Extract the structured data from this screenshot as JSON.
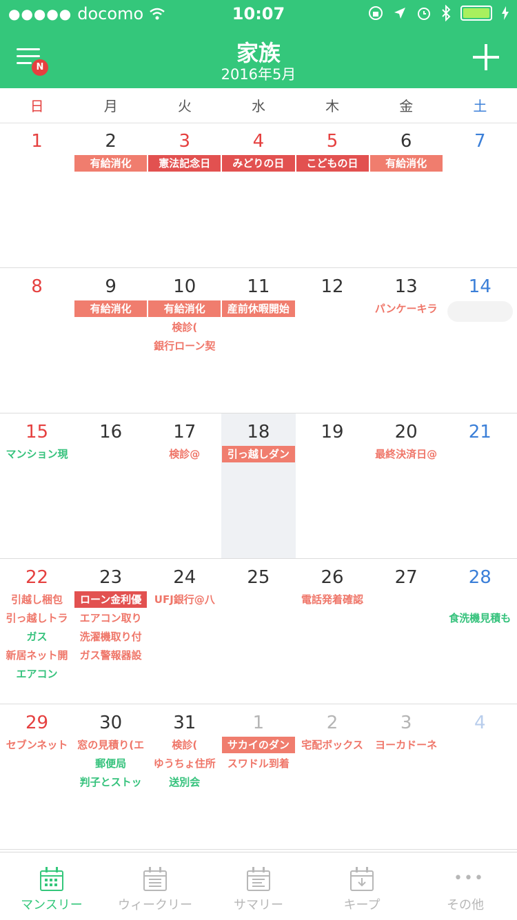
{
  "status": {
    "carrier": "docomo",
    "signal_dots": "●●●●●",
    "time": "10:07"
  },
  "header": {
    "title": "家族",
    "subtitle": "2016年5月",
    "badge": "N"
  },
  "weekdays": [
    "日",
    "月",
    "火",
    "水",
    "木",
    "金",
    "土"
  ],
  "weeks": [
    {
      "days": [
        {
          "n": "1",
          "t": "sun",
          "events": []
        },
        {
          "n": "2",
          "events": [
            {
              "label": "有給消化",
              "style": "fill"
            }
          ]
        },
        {
          "n": "3",
          "t": "sun",
          "events": [
            {
              "label": "憲法記念日",
              "style": "fill dark"
            }
          ]
        },
        {
          "n": "4",
          "t": "sun",
          "events": [
            {
              "label": "みどりの日",
              "style": "fill dark"
            }
          ]
        },
        {
          "n": "5",
          "t": "sun",
          "events": [
            {
              "label": "こどもの日",
              "style": "fill dark"
            }
          ]
        },
        {
          "n": "6",
          "events": [
            {
              "label": "有給消化",
              "style": "fill"
            }
          ]
        },
        {
          "n": "7",
          "t": "sat",
          "events": []
        }
      ]
    },
    {
      "days": [
        {
          "n": "8",
          "t": "sun",
          "events": []
        },
        {
          "n": "9",
          "events": [
            {
              "label": "有給消化",
              "style": "fill"
            }
          ]
        },
        {
          "n": "10",
          "events": [
            {
              "label": "有給消化",
              "style": "fill"
            },
            {
              "label": "検診(",
              "style": "text"
            },
            {
              "label": "銀行ローン契",
              "style": "text"
            }
          ]
        },
        {
          "n": "11",
          "events": [
            {
              "label": "産前休暇開始",
              "style": "fill"
            }
          ]
        },
        {
          "n": "12",
          "events": []
        },
        {
          "n": "13",
          "events": [
            {
              "label": "パンケーキラ",
              "style": "text"
            }
          ]
        },
        {
          "n": "14",
          "t": "sat",
          "events": [
            {
              "label": "",
              "style": "ghost"
            }
          ]
        }
      ]
    },
    {
      "days": [
        {
          "n": "15",
          "t": "sun",
          "events": [
            {
              "label": "マンション現",
              "style": "green"
            }
          ]
        },
        {
          "n": "16",
          "events": []
        },
        {
          "n": "17",
          "events": [
            {
              "label": "検診@",
              "style": "text"
            }
          ]
        },
        {
          "n": "18",
          "today": true,
          "events": [
            {
              "label": "引っ越しダン",
              "style": "fill"
            }
          ]
        },
        {
          "n": "19",
          "events": []
        },
        {
          "n": "20",
          "events": [
            {
              "label": "最終決済日@",
              "style": "text"
            }
          ]
        },
        {
          "n": "21",
          "t": "sat",
          "events": []
        }
      ]
    },
    {
      "days": [
        {
          "n": "22",
          "t": "sun",
          "events": [
            {
              "label": "引越し梱包",
              "style": "text"
            },
            {
              "label": "引っ越しトラ",
              "style": "text"
            },
            {
              "label": "ガス",
              "style": "green"
            },
            {
              "label": "新居ネット開",
              "style": "text"
            },
            {
              "label": "エアコン",
              "style": "green"
            }
          ]
        },
        {
          "n": "23",
          "events": [
            {
              "label": "ローン金利優",
              "style": "fill dark"
            },
            {
              "label": "エアコン取り",
              "style": "text"
            },
            {
              "label": "洗濯機取り付",
              "style": "text"
            },
            {
              "label": "ガス警報器設",
              "style": "text"
            }
          ]
        },
        {
          "n": "24",
          "events": [
            {
              "label": "UFJ銀行@八",
              "style": "text"
            }
          ]
        },
        {
          "n": "25",
          "events": []
        },
        {
          "n": "26",
          "events": [
            {
              "label": "電話発着確認",
              "style": "text"
            }
          ]
        },
        {
          "n": "27",
          "events": []
        },
        {
          "n": "28",
          "t": "sat",
          "events": [
            {
              "label": "",
              "style": "text"
            },
            {
              "label": "食洗機見積も",
              "style": "green overflow"
            }
          ]
        }
      ]
    },
    {
      "days": [
        {
          "n": "29",
          "t": "sun",
          "events": [
            {
              "label": "セブンネット",
              "style": "text"
            }
          ]
        },
        {
          "n": "30",
          "events": [
            {
              "label": "窓の見積り(エ",
              "style": "text"
            },
            {
              "label": "郵便局",
              "style": "green"
            },
            {
              "label": "判子とストッ",
              "style": "green"
            }
          ]
        },
        {
          "n": "31",
          "events": [
            {
              "label": "検診(",
              "style": "text"
            },
            {
              "label": "ゆうちょ住所",
              "style": "text"
            },
            {
              "label": "送別会",
              "style": "green"
            }
          ]
        },
        {
          "n": "1",
          "t": "other",
          "events": [
            {
              "label": "サカイのダン",
              "style": "fill"
            },
            {
              "label": "スワドル到着",
              "style": "text"
            }
          ]
        },
        {
          "n": "2",
          "t": "other",
          "events": [
            {
              "label": "宅配ボックス",
              "style": "text"
            }
          ]
        },
        {
          "n": "3",
          "t": "other",
          "events": [
            {
              "label": "ヨーカドーネ",
              "style": "text"
            }
          ]
        },
        {
          "n": "4",
          "t": "other sat",
          "events": []
        }
      ]
    }
  ],
  "tabs": [
    {
      "label": "マンスリー",
      "icon": "monthly-calendar-icon",
      "active": true
    },
    {
      "label": "ウィークリー",
      "icon": "weekly-calendar-icon",
      "active": false
    },
    {
      "label": "サマリー",
      "icon": "summary-calendar-icon",
      "active": false
    },
    {
      "label": "キープ",
      "icon": "keep-download-icon",
      "active": false
    },
    {
      "label": "その他",
      "icon": "more-dots-icon",
      "active": false
    }
  ],
  "colors": {
    "brand": "#34c77b",
    "holiday": "#e5403f",
    "saturday": "#3b7fd8",
    "event_fill": "#f07d6e"
  }
}
